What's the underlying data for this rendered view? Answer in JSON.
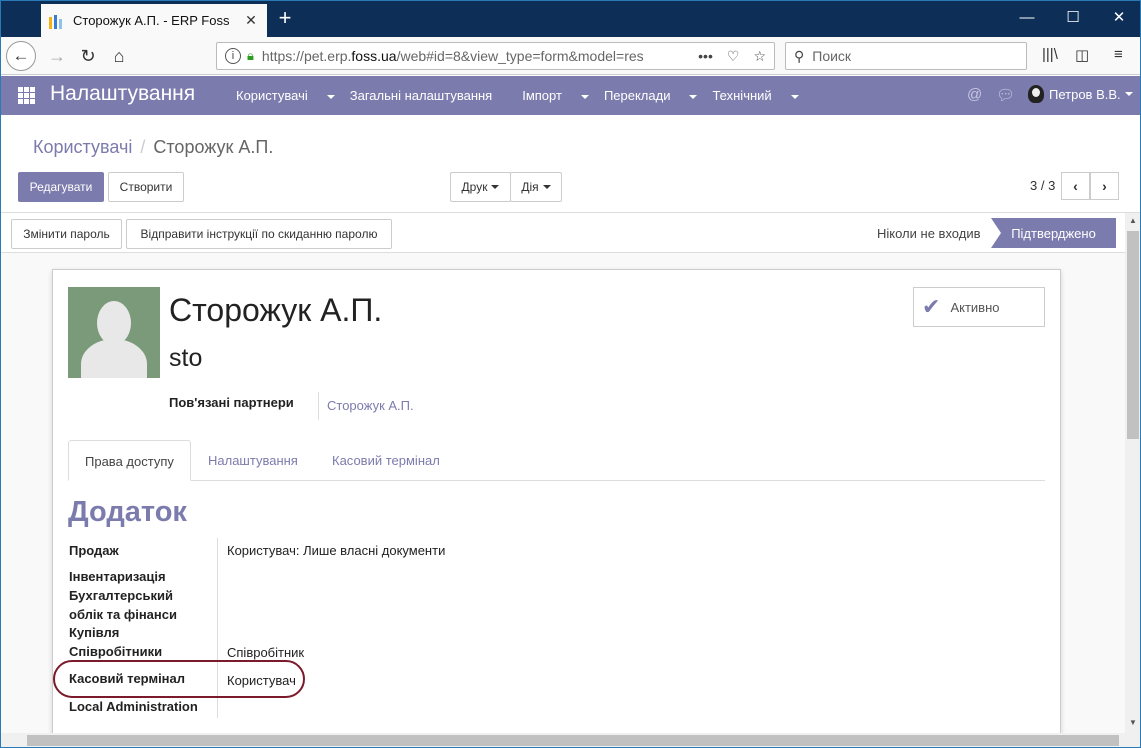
{
  "browser": {
    "tab_title": "Сторожук А.П. - ERP Foss",
    "url_prefix": "https://pet.erp.",
    "url_domain": "foss.ua",
    "url_rest": "/web#id=8&view_type=form&model=res",
    "search_placeholder": "Поиск"
  },
  "app": {
    "name": "Налаштування",
    "menu": [
      {
        "label": "Користувачі",
        "dropdown": true
      },
      {
        "label": "Загальні налаштування",
        "dropdown": false
      },
      {
        "label": "Імпорт",
        "dropdown": true
      },
      {
        "label": "Переклади",
        "dropdown": true
      },
      {
        "label": "Технічний",
        "dropdown": true
      }
    ],
    "user_name": "Петров В.В."
  },
  "breadcrumb": {
    "parent": "Користувачі",
    "current": "Сторожук А.П."
  },
  "actions": {
    "edit": "Редагувати",
    "create": "Створити",
    "print": "Друк",
    "action": "Дія",
    "pager": "3 / 3"
  },
  "header_buttons": {
    "change_password": "Змінити пароль",
    "send_reset": "Відправити інструкції по скиданню паролю"
  },
  "status": {
    "never": "Ніколи не входив",
    "confirmed": "Підтверджено"
  },
  "form": {
    "name": "Сторожук А.П.",
    "login": "sto",
    "active_label": "Активно",
    "partners_label": "Пов'язані партнери",
    "partners_value": "Сторожук А.П.",
    "tabs": [
      "Права доступу",
      "Налаштування",
      "Касовий термінал"
    ],
    "section_title": "Додаток",
    "fields": [
      {
        "label": "Продаж",
        "value": "Користувач: Лише власні документи"
      },
      {
        "label": "Інвентаризація",
        "value": ""
      },
      {
        "label": "Бухгалтерський облік та фінанси",
        "value": ""
      },
      {
        "label": "Купівля",
        "value": ""
      },
      {
        "label": "Співробітники",
        "value": "Співробітник"
      },
      {
        "label": "Касовий термінал",
        "value": "Користувач"
      },
      {
        "label": "Local Administration",
        "value": ""
      }
    ]
  },
  "colors": {
    "brand": "#7c7bad",
    "highlight": "#7b1a2a"
  }
}
